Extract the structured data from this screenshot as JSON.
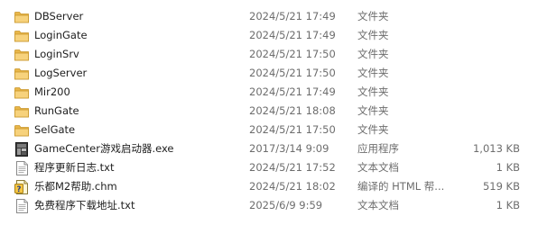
{
  "files": [
    {
      "name": "DBServer",
      "date": "2024/5/21 17:49",
      "type": "文件夹",
      "size": "",
      "icon": "folder-icon"
    },
    {
      "name": "LoginGate",
      "date": "2024/5/21 17:49",
      "type": "文件夹",
      "size": "",
      "icon": "folder-icon"
    },
    {
      "name": "LoginSrv",
      "date": "2024/5/21 17:50",
      "type": "文件夹",
      "size": "",
      "icon": "folder-icon"
    },
    {
      "name": "LogServer",
      "date": "2024/5/21 17:50",
      "type": "文件夹",
      "size": "",
      "icon": "folder-icon"
    },
    {
      "name": "Mir200",
      "date": "2024/5/21 17:49",
      "type": "文件夹",
      "size": "",
      "icon": "folder-icon"
    },
    {
      "name": "RunGate",
      "date": "2024/5/21 18:08",
      "type": "文件夹",
      "size": "",
      "icon": "folder-icon"
    },
    {
      "name": "SelGate",
      "date": "2024/5/21 17:50",
      "type": "文件夹",
      "size": "",
      "icon": "folder-icon"
    },
    {
      "name": "GameCenter游戏启动器.exe",
      "date": "2017/3/14 9:09",
      "type": "应用程序",
      "size": "1,013 KB",
      "icon": "app-icon"
    },
    {
      "name": "程序更新日志.txt",
      "date": "2024/5/21 17:52",
      "type": "文本文档",
      "size": "1 KB",
      "icon": "text-file-icon"
    },
    {
      "name": "乐都M2帮助.chm",
      "date": "2024/5/21 18:02",
      "type": "编译的 HTML 帮...",
      "size": "519 KB",
      "icon": "help-file-icon"
    },
    {
      "name": "免费程序下载地址.txt",
      "date": "2025/6/9 9:59",
      "type": "文本文档",
      "size": "1 KB",
      "icon": "text-file-icon"
    }
  ]
}
